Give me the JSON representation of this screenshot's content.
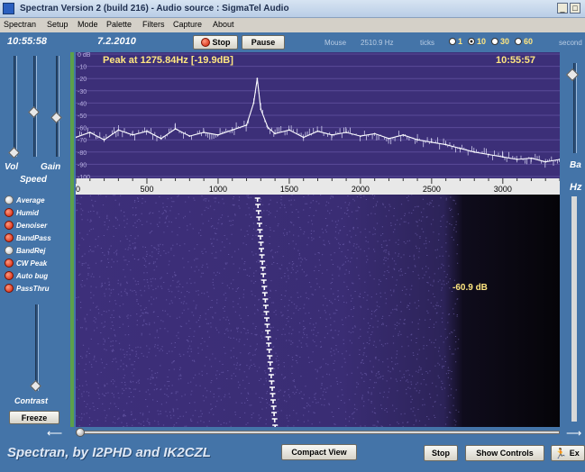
{
  "window": {
    "title": "Spectran Version 2 (build 216) - Audio source : SigmaTel Audio",
    "minimize": "_",
    "maximize": "□"
  },
  "menu": [
    "Spectran",
    "Setup",
    "Mode",
    "Palette",
    "Filters",
    "Capture",
    "About"
  ],
  "toolbar": {
    "time": "10:55:58",
    "date": "7.2.2010",
    "stop_label": "Stop",
    "pause_label": "Pause",
    "mouse_label": "Mouse",
    "mouse_value": "2510.9 Hz",
    "ticks_label": "ticks",
    "tick_options": [
      "1",
      "10",
      "30",
      "60"
    ],
    "tick_selected": "10",
    "seconds_label": "second"
  },
  "left_panel": {
    "vol_label": "Vol",
    "gain_label": "Gain",
    "speed_label": "Speed",
    "contrast_label": "Contrast",
    "freeze_label": "Freeze",
    "options": [
      {
        "label": "Average",
        "state": "white"
      },
      {
        "label": "Humid",
        "state": "red"
      },
      {
        "label": "Denoiser",
        "state": "red"
      },
      {
        "label": "BandPass",
        "state": "red"
      },
      {
        "label": "BandRej",
        "state": "white"
      },
      {
        "label": "CW Peak",
        "state": "red"
      },
      {
        "label": "Auto bug",
        "state": "red"
      },
      {
        "label": "PassThru",
        "state": "red"
      }
    ]
  },
  "right_panel": {
    "bar_label": "Ba",
    "hz_label": "Hz"
  },
  "spectrum": {
    "peak_text": "Peak at  1275.84Hz [-19.9dB]",
    "clock": "10:55:57",
    "db_labels": [
      "0 dB",
      "-10",
      "-20",
      "-30",
      "-40",
      "-50",
      "-60",
      "-70",
      "-80",
      "-90",
      "-100"
    ],
    "freq_ticks": [
      "0",
      "500",
      "1000",
      "1500",
      "2000",
      "2500",
      "3000"
    ]
  },
  "waterfall": {
    "level_readout": "-60.9 dB"
  },
  "bottom": {
    "credit": "Spectran, by I2PHD and IK2CZL",
    "compact_view_label": "Compact View",
    "stop_label": "Stop",
    "show_controls_label": "Show Controls",
    "exit_label": "Ex"
  },
  "colors": {
    "panel_blue": "#4474a8",
    "spectrum_bg": "#3c2f78",
    "peak_text": "#ffe680",
    "accent_red": "#d01a00"
  },
  "chart_data": {
    "type": "line",
    "title": "Peak at  1275.84Hz [-19.9dB]",
    "xlabel": "",
    "ylabel": "",
    "xlim": [
      0,
      3400
    ],
    "ylim": [
      -100,
      0
    ],
    "x": [
      0,
      100,
      200,
      300,
      400,
      500,
      600,
      700,
      800,
      900,
      1000,
      1100,
      1200,
      1250,
      1275,
      1300,
      1350,
      1400,
      1500,
      1600,
      1700,
      1800,
      1900,
      2000,
      2100,
      2200,
      2300,
      2400,
      2500,
      2600,
      2700,
      2800,
      2900,
      3000,
      3100,
      3200,
      3300,
      3400
    ],
    "series": [
      {
        "values": [
          -68,
          -64,
          -70,
          -62,
          -66,
          -63,
          -69,
          -61,
          -67,
          -64,
          -66,
          -62,
          -58,
          -40,
          -20,
          -45,
          -60,
          -65,
          -62,
          -68,
          -63,
          -66,
          -64,
          -67,
          -65,
          -69,
          -66,
          -70,
          -72,
          -74,
          -77,
          -80,
          -82,
          -84,
          -86,
          -85,
          -88,
          -86
        ]
      }
    ],
    "grid": true,
    "legend": "none"
  }
}
